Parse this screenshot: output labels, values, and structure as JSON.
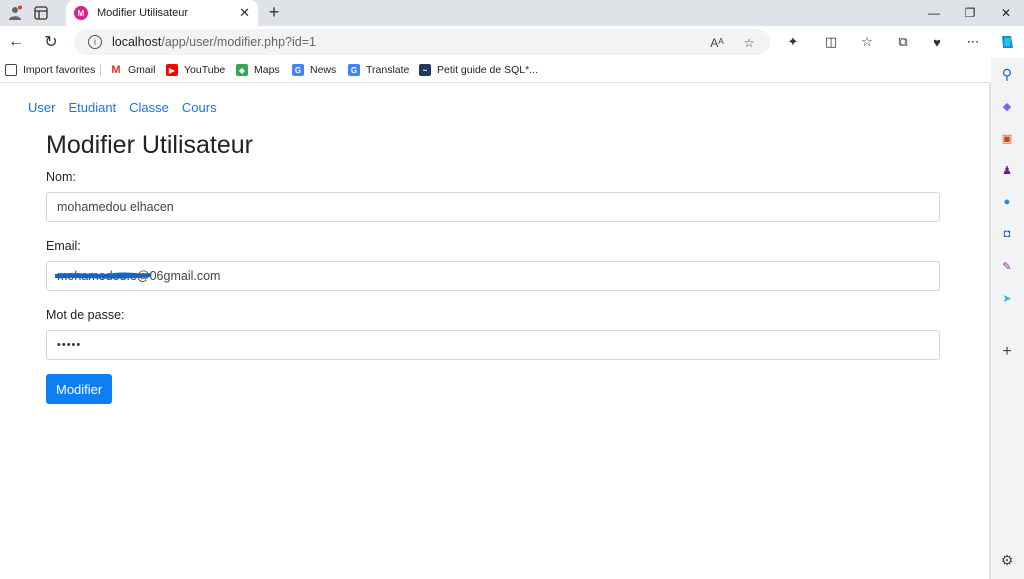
{
  "browser": {
    "tab": {
      "title": "Modifier Utilisateur",
      "favicon": "tab-favicon",
      "close": "✕"
    },
    "new_tab": "+",
    "url": {
      "host": "localhost",
      "path": "/app/user/modifier.php?id=1"
    },
    "bookmarks": [
      {
        "label": "Import favorites",
        "icon": "folder-icon"
      },
      {
        "label": "Gmail",
        "icon": "gmail-icon"
      },
      {
        "label": "YouTube",
        "icon": "youtube-icon"
      },
      {
        "label": "Maps",
        "icon": "maps-icon"
      },
      {
        "label": "News",
        "icon": "news-icon"
      },
      {
        "label": "Translate",
        "icon": "translate-icon"
      },
      {
        "label": "Petit guide de SQL*...",
        "icon": "sql-guide-icon"
      }
    ]
  },
  "site": {
    "nav": [
      "User",
      "Etudiant",
      "Classe",
      "Cours"
    ],
    "title": "Modifier Utilisateur",
    "form": {
      "name_label": "Nom:",
      "name_value": "mohamedou elhacen",
      "email_label": "Email:",
      "email_value": "mohamedou.e@06gmail.com",
      "password_label": "Mot de passe:",
      "password_value": "•••••",
      "submit_label": "Modifier"
    }
  },
  "colors": {
    "link": "#1a73e8",
    "button": "#0d7ff2",
    "redaction": "#1565c0"
  }
}
